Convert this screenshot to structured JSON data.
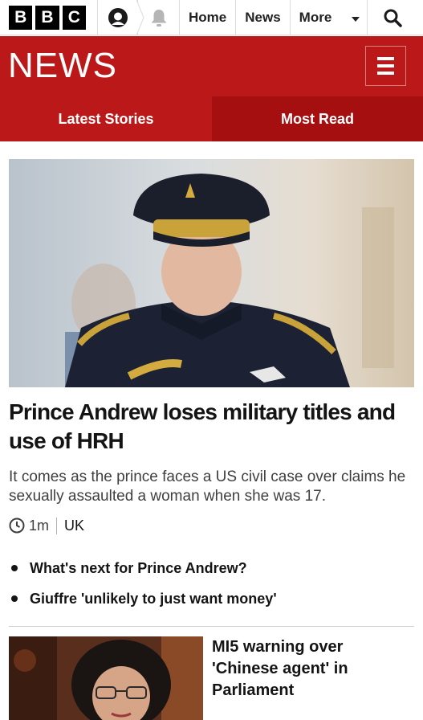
{
  "header": {
    "brand_letters": [
      "B",
      "B",
      "C"
    ],
    "nav": [
      {
        "label": "Home"
      },
      {
        "label": "News"
      }
    ],
    "more_label": "More",
    "icons": {
      "account": "account-icon",
      "notifications": "bell-icon",
      "dropdown": "caret-down-icon",
      "search": "search-icon"
    }
  },
  "banner": {
    "title": "NEWS",
    "menu_icon": "hamburger-menu-icon",
    "color": "#bb1919"
  },
  "tabs": [
    {
      "label": "Latest Stories",
      "active": false
    },
    {
      "label": "Most Read",
      "active": true
    }
  ],
  "lead_story": {
    "headline": "Prince Andrew loses military titles and use of HRH",
    "summary": "It comes as the prince faces a US civil case over claims he sexually assaulted a woman when she was 17.",
    "timestamp": "1m",
    "section": "UK",
    "related": [
      {
        "label": "What's next for Prince Andrew?"
      },
      {
        "label": "Giuffre 'unlikely to just want money'"
      }
    ]
  },
  "second_story": {
    "headline": "MI5 warning over 'Chinese agent' in Parliament"
  },
  "colors": {
    "accent": "#bb1919",
    "accent_dark": "#a50f0f",
    "text": "#141414",
    "secondary_text": "#3f3f42"
  }
}
